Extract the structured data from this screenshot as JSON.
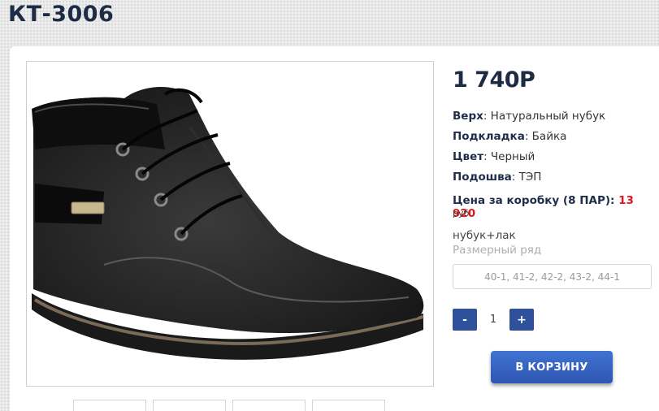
{
  "product": {
    "title": "КТ-3006",
    "price": "1 740Р",
    "specs": [
      {
        "label": "Верх",
        "value": "Натуральный нубук"
      },
      {
        "label": "Подкладка",
        "value": "Байка"
      },
      {
        "label": "Цвет",
        "value": "Черный"
      },
      {
        "label": "Подошва",
        "value": "ТЭП"
      }
    ],
    "box_price_label": "Цена за коробку (8 ПАР):",
    "box_price_value": "13 920",
    "box_price_currency": "руб",
    "material": "нубук+лак",
    "size_title": "Размерный ряд",
    "sizes": "40-1, 41-2, 42-2, 43-2, 44-1"
  },
  "cart": {
    "minus_label": "-",
    "plus_label": "+",
    "quantity": "1",
    "add_label": "В КОРЗИНУ"
  },
  "gallery": {
    "image_icon": "black-nubuck-ankle-boot",
    "thumbnail_count": 4
  },
  "colors": {
    "title": "#1e2b45",
    "button": "#2f519b",
    "price_accent": "#e3141b"
  }
}
